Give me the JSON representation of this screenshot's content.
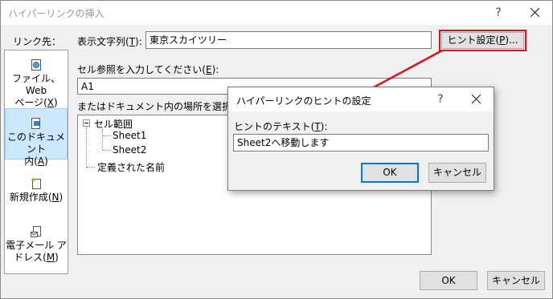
{
  "window": {
    "title": "ハイパーリンクの挿入",
    "help_symbol": "?",
    "close_symbol": "✕"
  },
  "link_to": {
    "label": "リンク先：",
    "items": [
      {
        "label_line1": "ファイル、Web",
        "label_line2": "ページ(",
        "mnemonic": "X",
        "label_end": ")",
        "icon": "web-page-icon"
      },
      {
        "label_line1": "このドキュメント",
        "label_line2": "内(",
        "mnemonic": "A",
        "label_end": ")",
        "icon": "document-place-icon",
        "selected": true
      },
      {
        "label_line1": "新規作成(",
        "mnemonic": "N",
        "label_end": ")",
        "icon": "new-document-icon"
      },
      {
        "label_line1": "電子メール ア",
        "label_line2": "ドレス(",
        "mnemonic": "M",
        "label_end": ")",
        "icon": "email-icon"
      }
    ]
  },
  "display_text": {
    "label_prefix": "表示文字列(",
    "mnemonic": "T",
    "label_suffix": "):",
    "value": "東京スカイツリー"
  },
  "screentip_button": {
    "label_prefix": "ヒント設定(",
    "mnemonic": "P",
    "label_suffix": ")..."
  },
  "cell_ref": {
    "label_prefix": "セル参照を入力してください(",
    "mnemonic": "E",
    "label_suffix": "):",
    "value": "A1"
  },
  "place_label": "またはドキュメント内の場所を選択してくだ",
  "tree": {
    "root": "セル範囲",
    "children": [
      "Sheet1",
      "Sheet2"
    ],
    "defined_names": "定義された名前"
  },
  "buttons": {
    "ok": "OK",
    "cancel": "キャンセル"
  },
  "screentip_dialog": {
    "title": "ハイパーリンクのヒントの設定",
    "help_symbol": "?",
    "close_symbol": "✕",
    "label_prefix": "ヒントのテキスト(",
    "mnemonic": "T",
    "label_suffix": "):",
    "value": "Sheet2へ移動します",
    "ok": "OK",
    "cancel": "キャンセル"
  },
  "colors": {
    "annotation": "#e0101a",
    "selection": "#cce8ff",
    "focus": "#0078d7"
  }
}
